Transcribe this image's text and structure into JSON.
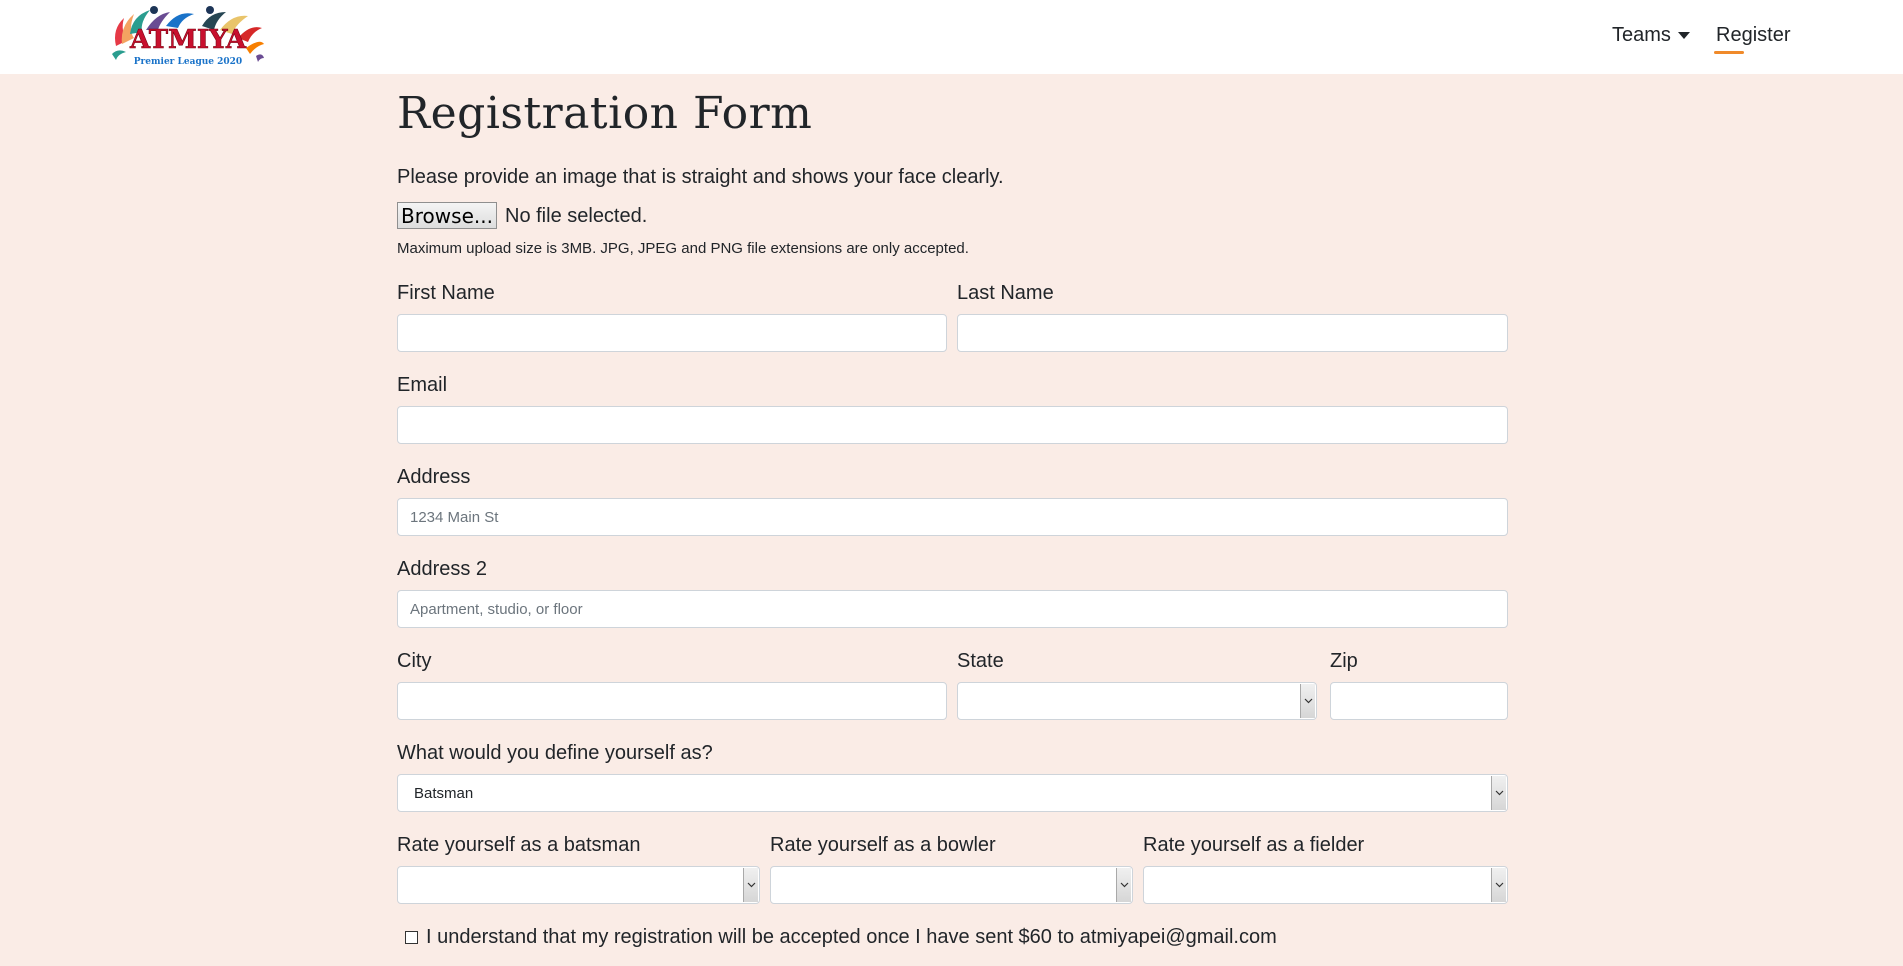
{
  "navbar": {
    "logo_text": "ATMIYA",
    "logo_subtext": "Premier League 2020",
    "teams_label": "Teams",
    "register_label": "Register"
  },
  "form": {
    "title": "Registration Form",
    "photo_instruction": "Please provide an image that is straight and shows your face clearly.",
    "browse_label": "Browse...",
    "file_status": "No file selected.",
    "upload_hint": "Maximum upload size is 3MB. JPG, JPEG and PNG file extensions are only accepted.",
    "first_name": {
      "label": "First Name",
      "value": "",
      "placeholder": ""
    },
    "last_name": {
      "label": "Last Name",
      "value": "",
      "placeholder": ""
    },
    "email": {
      "label": "Email",
      "value": "",
      "placeholder": ""
    },
    "address": {
      "label": "Address",
      "value": "",
      "placeholder": "1234 Main St"
    },
    "address2": {
      "label": "Address 2",
      "value": "",
      "placeholder": "Apartment, studio, or floor"
    },
    "city": {
      "label": "City",
      "value": "",
      "placeholder": ""
    },
    "state": {
      "label": "State",
      "selected": ""
    },
    "zip": {
      "label": "Zip",
      "value": "",
      "placeholder": ""
    },
    "role": {
      "label": "What would you define yourself as?",
      "selected": "Batsman"
    },
    "batsman_rating": {
      "label": "Rate yourself as a batsman",
      "selected": ""
    },
    "bowler_rating": {
      "label": "Rate yourself as a bowler",
      "selected": ""
    },
    "fielder_rating": {
      "label": "Rate yourself as a fielder",
      "selected": ""
    },
    "agreement": {
      "label": "I understand that my registration will be accepted once I have sent $60 to atmiyapei@gmail.com",
      "checked": false
    }
  },
  "colors": {
    "page_background": "#faece6",
    "navbar_background": "#ffffff",
    "active_nav_underline": "#f08a2a",
    "logo_red": "#c8102e",
    "logo_blue": "#1a73c9"
  }
}
